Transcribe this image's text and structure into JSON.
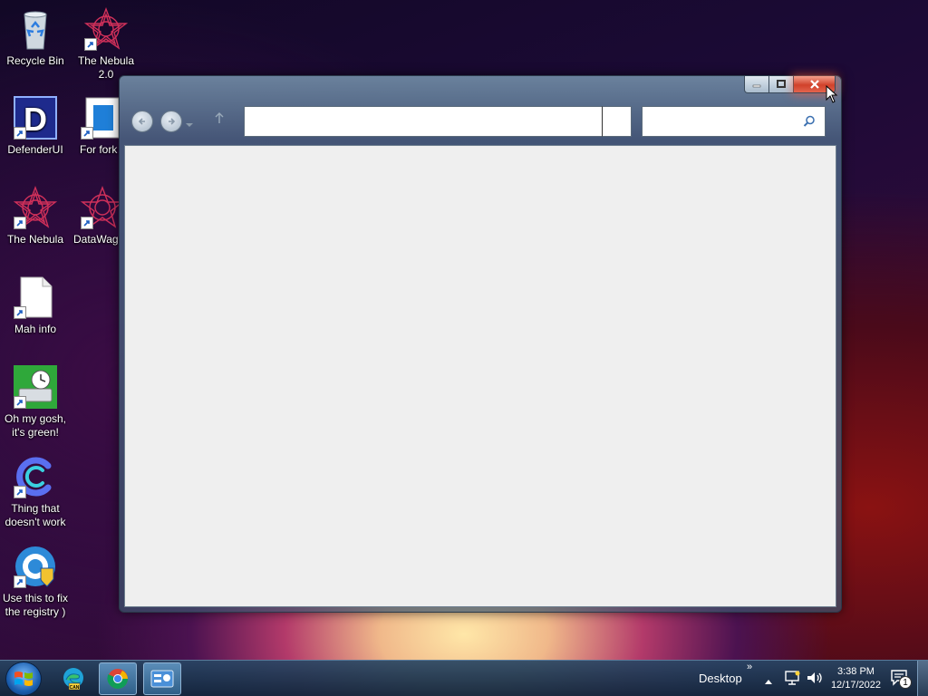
{
  "desktop": {
    "icons": [
      {
        "label": "Recycle Bin",
        "icon": "recycle-bin-icon"
      },
      {
        "label": "The Nebula 2.0",
        "icon": "nebula-icon"
      },
      {
        "label": "DefenderUI",
        "icon": "defenderui-icon"
      },
      {
        "label": "For fork",
        "icon": "document-icon"
      },
      {
        "label": "The Nebula",
        "icon": "nebula-icon"
      },
      {
        "label": "DataWag",
        "icon": "nebula-icon"
      },
      {
        "label": "Mah info",
        "icon": "blank-file-icon"
      },
      {
        "label": "Oh my gosh, it's green!",
        "icon": "drive-clock-icon"
      },
      {
        "label": "Thing that doesn't work",
        "icon": "ccleaner-icon"
      },
      {
        "label": "Use this to fix the registry )",
        "icon": "registry-tool-icon"
      }
    ]
  },
  "explorer": {
    "address_value": "",
    "search_value": "",
    "buttons": {
      "minimize": "minimize-icon",
      "maximize": "maximize-icon",
      "close": "close-icon"
    }
  },
  "taskbar": {
    "apps": [
      {
        "icon": "edge-can-icon"
      },
      {
        "icon": "chrome-icon",
        "active": true
      },
      {
        "icon": "control-panel-icon",
        "active": true
      }
    ],
    "toolbar_label": "Desktop",
    "time": "3:38 PM",
    "date": "12/17/2022",
    "notification_count": "1"
  },
  "colors": {
    "close_button": "#d0412a",
    "taskbar": "#1a3350",
    "content_bg": "#efefef"
  }
}
